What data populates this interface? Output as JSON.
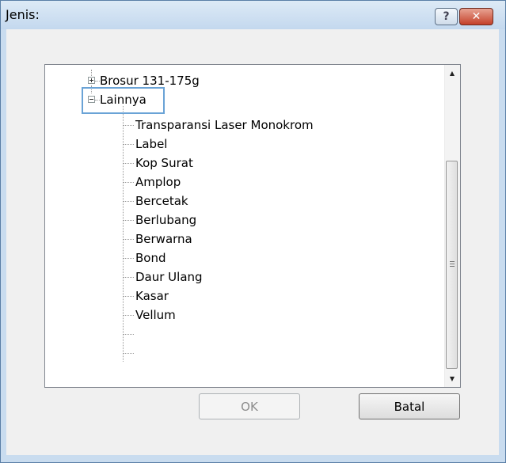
{
  "dialog": {
    "title": "Jenis:",
    "help_glyph": "?",
    "close_glyph": "✕"
  },
  "tree": {
    "items": [
      {
        "label": "Brosur 131-175g",
        "expander": "plus"
      },
      {
        "label": "Lainnya",
        "expander": "minus",
        "selected": true
      },
      {
        "label": "Transparansi Laser Monokrom"
      },
      {
        "label": "Label"
      },
      {
        "label": "Kop Surat"
      },
      {
        "label": "Amplop"
      },
      {
        "label": "Bercetak"
      },
      {
        "label": "Berlubang"
      },
      {
        "label": "Berwarna"
      },
      {
        "label": "Bond"
      },
      {
        "label": "Daur Ulang"
      },
      {
        "label": "Kasar"
      },
      {
        "label": "Vellum"
      }
    ]
  },
  "scrollbar": {
    "up_glyph": "▲",
    "down_glyph": "▼"
  },
  "buttons": {
    "ok_label": "OK",
    "cancel_label": "Batal"
  }
}
